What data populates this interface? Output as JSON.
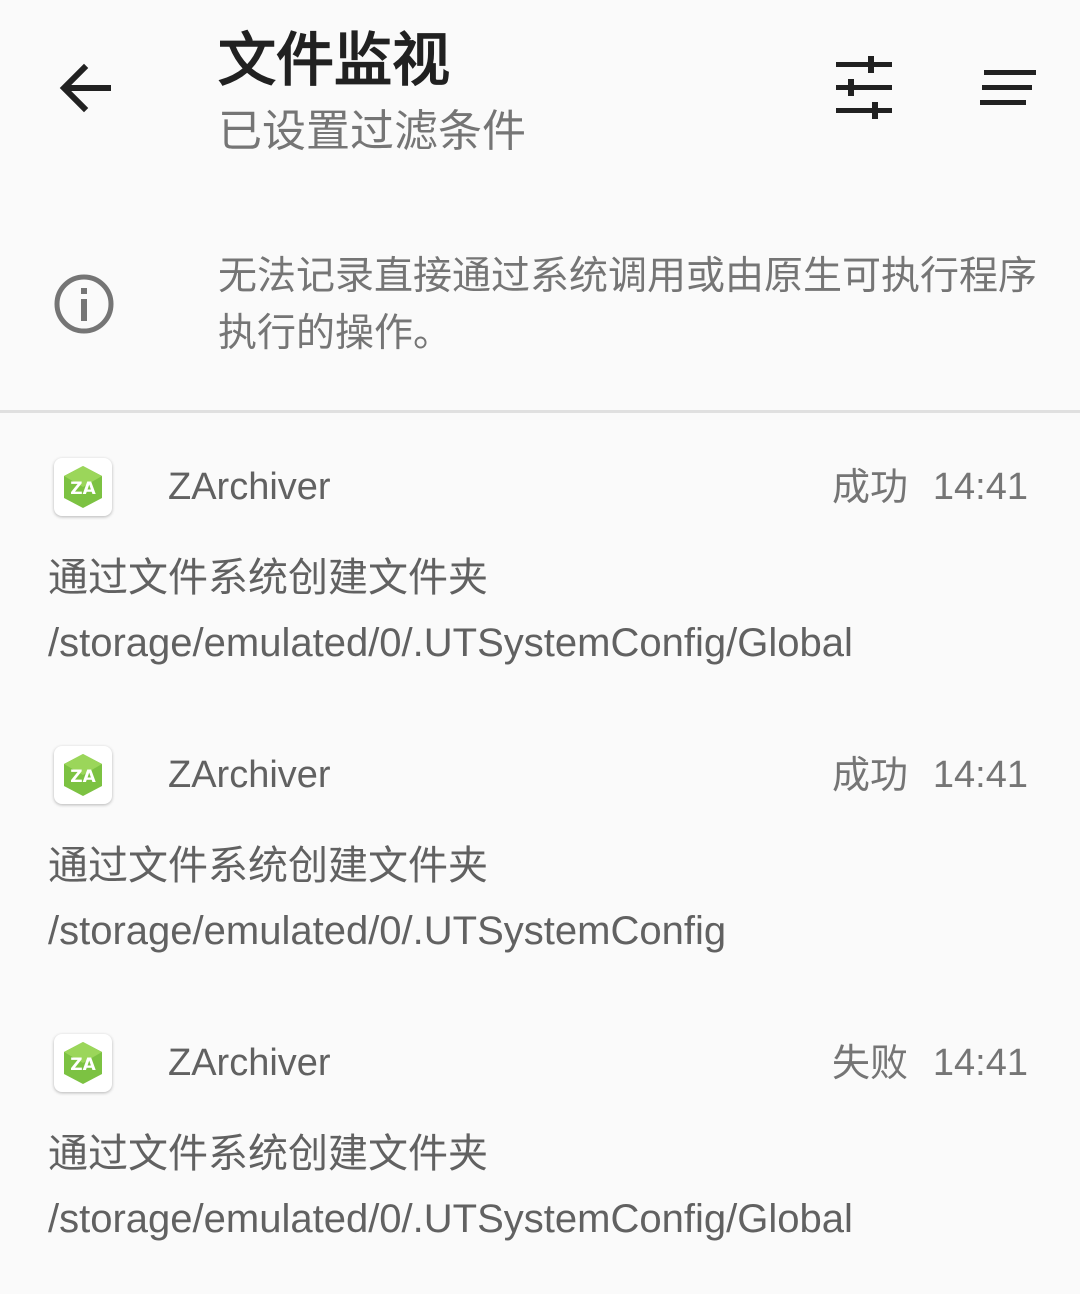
{
  "header": {
    "title": "文件监视",
    "subtitle": "已设置过滤条件",
    "icons": {
      "back": "arrow-back-icon",
      "filter": "tune-icon",
      "sort": "sort-icon"
    }
  },
  "info": {
    "icon": "info-icon",
    "text": "无法记录直接通过系统调用或由原生可执行程序执行的操作。"
  },
  "entries": [
    {
      "app": "ZArchiver",
      "status": "成功",
      "time": "14:41",
      "operation": "通过文件系统创建文件夹",
      "path": "/storage/emulated/0/.UTSystemConfig/Global"
    },
    {
      "app": "ZArchiver",
      "status": "成功",
      "time": "14:41",
      "operation": "通过文件系统创建文件夹",
      "path": "/storage/emulated/0/.UTSystemConfig"
    },
    {
      "app": "ZArchiver",
      "status": "失败",
      "time": "14:41",
      "operation": "通过文件系统创建文件夹",
      "path": "/storage/emulated/0/.UTSystemConfig/Global"
    }
  ],
  "colors": {
    "background": "#fafafa",
    "primary_text": "#212121",
    "secondary_text": "#757575",
    "zarchiver_green": "#7cc242"
  }
}
